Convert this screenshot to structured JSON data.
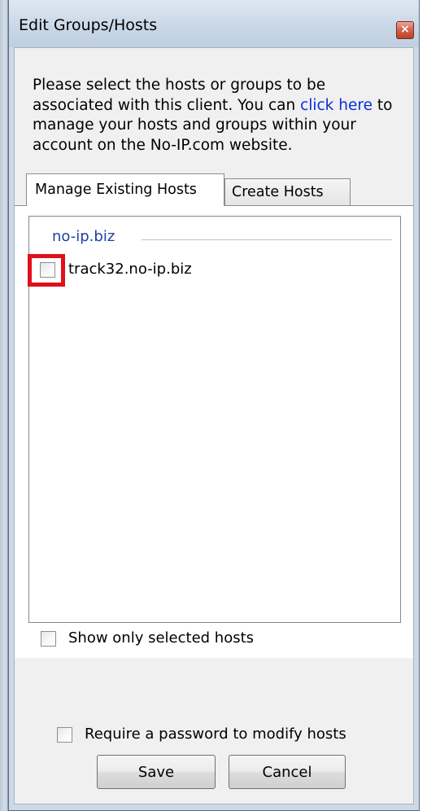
{
  "window": {
    "title": "Edit Groups/Hosts",
    "close_glyph": "×"
  },
  "description": {
    "text_before": "Please select the hosts or groups to be associated with this client. You can ",
    "link_text": "click here",
    "text_after": " to manage your hosts and groups within your account on the No-IP.com website."
  },
  "tabs": [
    {
      "label": "Manage Existing Hosts",
      "active": true
    },
    {
      "label": "Create Hosts",
      "active": false
    }
  ],
  "host_list": {
    "group": "no-ip.biz",
    "hosts": [
      {
        "name": "track32.no-ip.biz",
        "checked": false,
        "highlighted": true
      }
    ]
  },
  "options": {
    "show_only_selected": {
      "label": "Show only selected hosts",
      "checked": false
    },
    "require_password": {
      "label": "Require a password to modify hosts",
      "checked": false
    }
  },
  "buttons": {
    "save": "Save",
    "cancel": "Cancel"
  },
  "colors": {
    "link": "#0b2fd4",
    "group_header": "#1e3fa8",
    "highlight": "#e0101a"
  }
}
